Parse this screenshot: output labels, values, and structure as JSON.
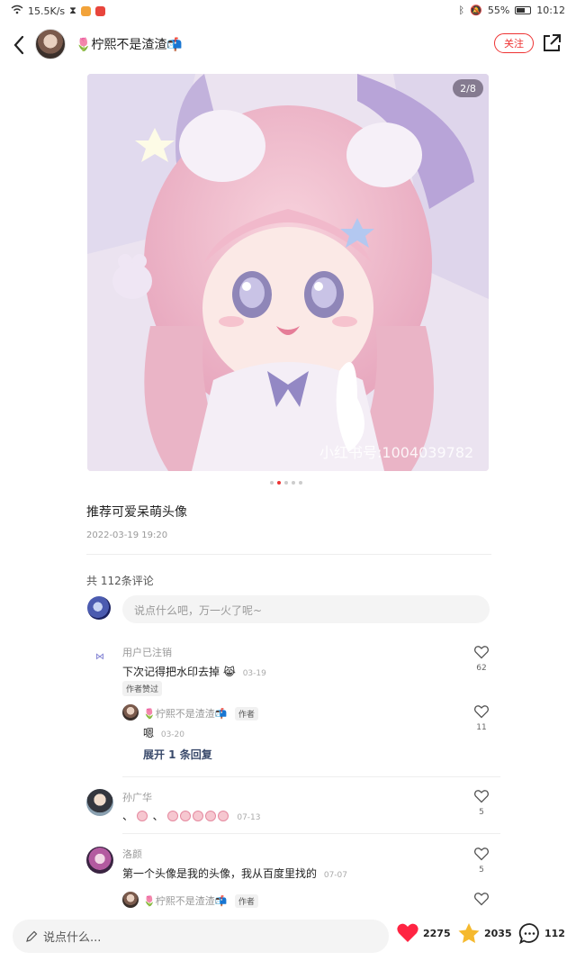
{
  "status_bar": {
    "network_speed": "15.5K/s",
    "battery": "55%",
    "time": "10:12"
  },
  "header": {
    "author_name": "🌷柠熙不是渣渣📬",
    "follow_label": "关注"
  },
  "post": {
    "image_page": "2/8",
    "watermark": "小红书号:1004039782",
    "title": "推荐可爱呆萌头像",
    "date": "2022-03-19 19:20",
    "image_count": 5,
    "active_image_index": 2
  },
  "comments_section": {
    "count_label": "共 112条评论",
    "input_placeholder": "说点什么吧，万一火了呢~",
    "comments": [
      {
        "user": "用户已注销",
        "text": "下次记得把水印去掉",
        "date": "03-19",
        "likes": "62",
        "badge": "作者赞过",
        "reply": {
          "user": "🌷柠熙不是渣渣📬",
          "author_tag": "作者",
          "text": "嗯",
          "date": "03-20",
          "likes": "11"
        },
        "expand_label": "展开 1 条回复"
      },
      {
        "user": "孙广华",
        "text": "、",
        "date": "07-13",
        "likes": "5"
      },
      {
        "user": "洛颜",
        "text": "第一个头像是我的头像，我从百度里找的",
        "date": "07-07",
        "likes": "5",
        "reply": {
          "user": "🌷柠熙不是渣渣📬",
          "author_tag": "作者"
        }
      }
    ]
  },
  "bottom_bar": {
    "input_placeholder": "说点什么...",
    "likes": "2275",
    "collects": "2035",
    "comments": "112"
  },
  "colors": {
    "accent": "#ff2442",
    "star": "#f5b92e"
  }
}
